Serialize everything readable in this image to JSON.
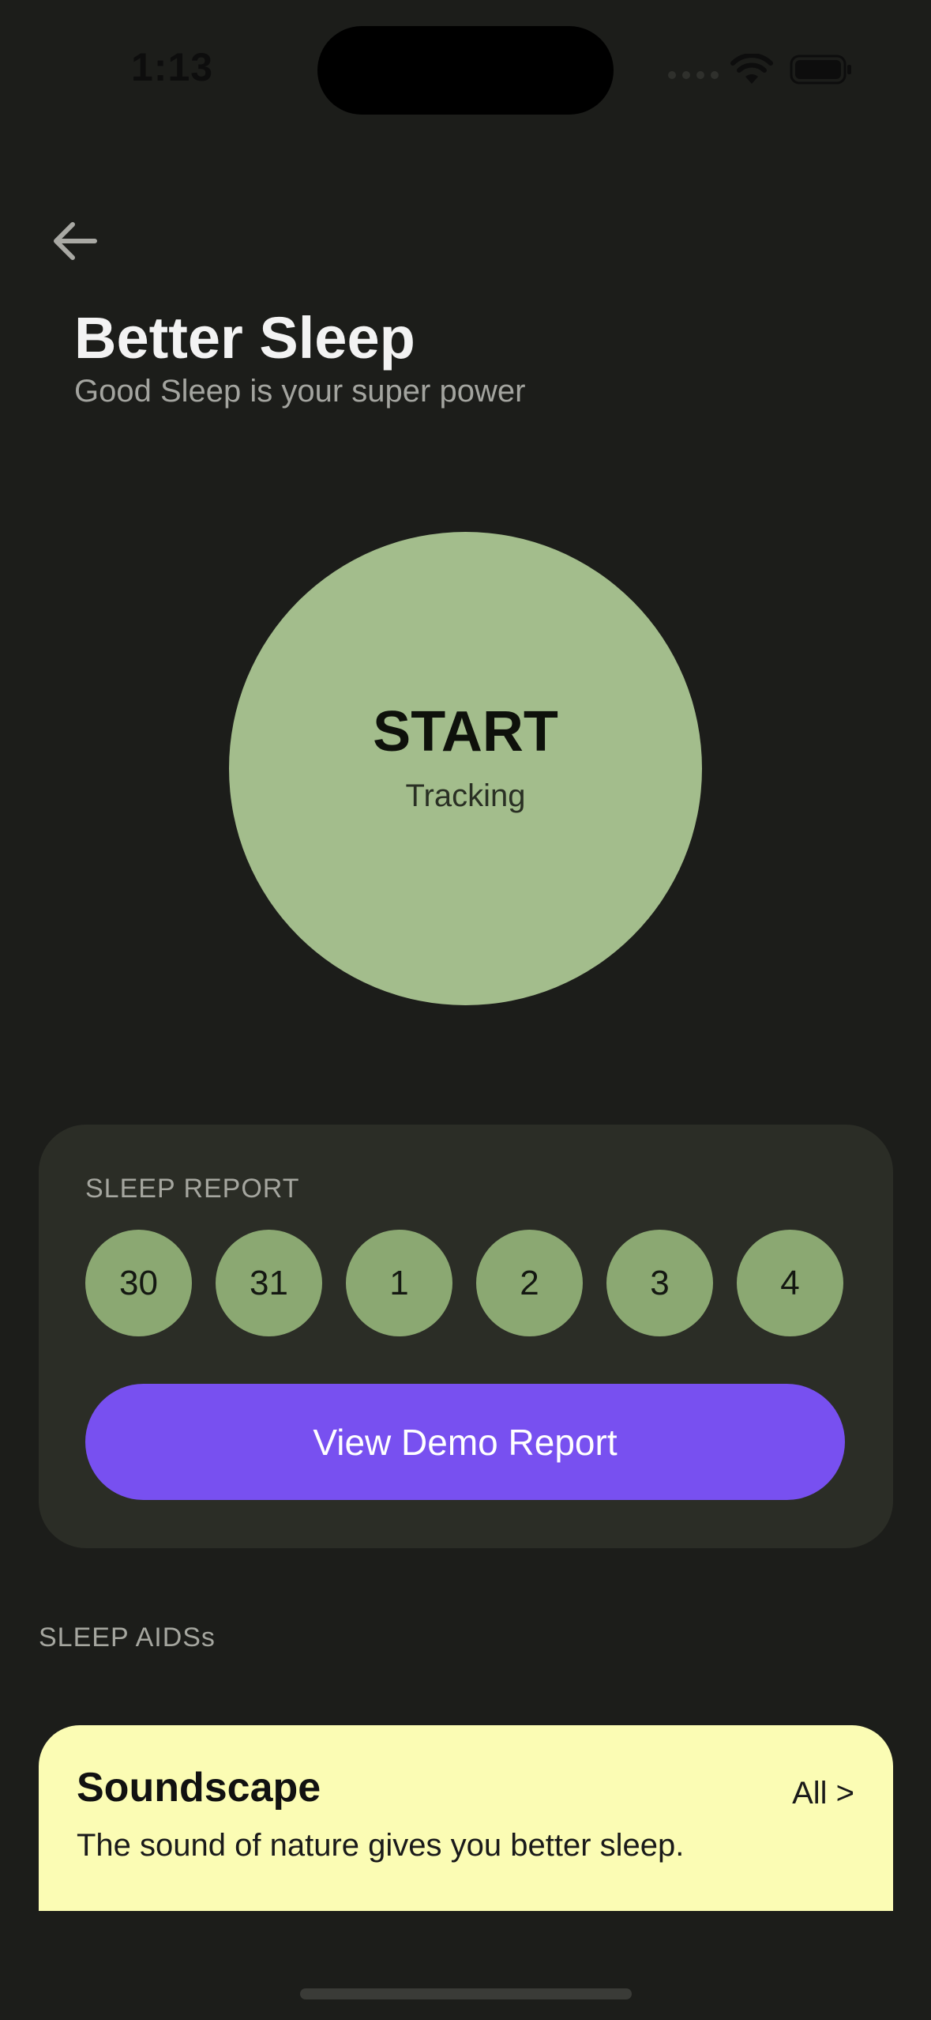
{
  "status_bar": {
    "time": "1:13",
    "icons": [
      "signal-icon",
      "wifi-icon",
      "battery-icon"
    ]
  },
  "header": {
    "back_icon": "arrow-left-icon",
    "title": "Better Sleep",
    "subtitle": "Good Sleep is your super power"
  },
  "start_button": {
    "label": "START",
    "sublabel": "Tracking"
  },
  "sleep_report": {
    "heading": "SLEEP REPORT",
    "days": [
      "30",
      "31",
      "1",
      "2",
      "3",
      "4"
    ],
    "button_label": "View Demo Report"
  },
  "sleep_aids": {
    "heading": "SLEEP AIDSs",
    "cards": [
      {
        "title": "Soundscape",
        "description": "The sound of nature gives you better sleep.",
        "link": "All >"
      }
    ]
  },
  "colors": {
    "background": "#1c1d1a",
    "start_circle": "#a3bd8c",
    "report_card": "#2b2d26",
    "day_circle": "#8ba872",
    "primary_button": "#7850f0",
    "soundscape_card": "#fbfcb4"
  }
}
